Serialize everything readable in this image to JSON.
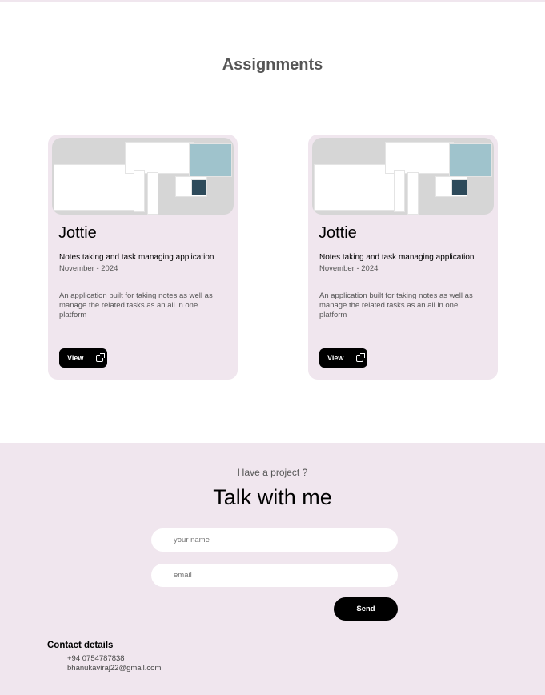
{
  "section_title": "Assignments",
  "cards": [
    {
      "title": "Jottie",
      "subtitle": "Notes taking and task managing application",
      "date": "November - 2024",
      "description": "An application built for taking notes as well as manage the related tasks as an all in one platform",
      "button": "View"
    },
    {
      "title": "Jottie",
      "subtitle": "Notes taking and task managing application",
      "date": "November - 2024",
      "description": "An application built for taking notes as well as manage the related tasks as an all in one platform",
      "button": "View"
    }
  ],
  "contact": {
    "kicker": "Have a project ?",
    "heading": "Talk with me",
    "name_placeholder": "your name",
    "email_placeholder": "email",
    "send": "Send",
    "details_title": "Contact details",
    "phone": "+94 0754787838",
    "email": "bhanukaviraj22@gmail.com"
  }
}
